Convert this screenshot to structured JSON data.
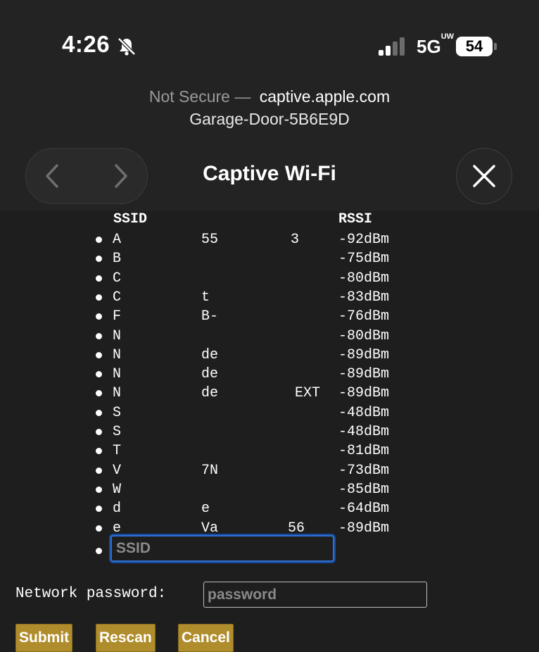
{
  "status_bar": {
    "time": "4:26",
    "network": "5G",
    "network_sup": "UW",
    "battery": "54",
    "icons": [
      "bell-slash-icon",
      "signal-icon"
    ]
  },
  "browser": {
    "security": "Not Secure —",
    "host": "captive.apple.com",
    "page_title": "Garage-Door-5B6E9D",
    "sheet_title": "Captive Wi-Fi",
    "icons": [
      "back-icon",
      "forward-icon",
      "close-icon"
    ]
  },
  "networks": {
    "header_ssid": "SSID",
    "header_rssi": "RSSI",
    "items": [
      {
        "ssid": "A",
        "frag1": "55",
        "frag2": "3",
        "rssi": "-92dBm"
      },
      {
        "ssid": "B",
        "frag1": "",
        "frag2": "",
        "rssi": "-75dBm"
      },
      {
        "ssid": "C",
        "frag1": "",
        "frag2": "",
        "rssi": "-80dBm"
      },
      {
        "ssid": "C",
        "frag1": "t",
        "frag2": "",
        "rssi": "-83dBm"
      },
      {
        "ssid": "F",
        "frag1": "B-",
        "frag2": "",
        "rssi": "-76dBm"
      },
      {
        "ssid": "N",
        "frag1": "",
        "frag2": "",
        "rssi": "-80dBm"
      },
      {
        "ssid": "N",
        "frag1": "de",
        "frag2": "",
        "rssi": "-89dBm"
      },
      {
        "ssid": "N",
        "frag1": "de",
        "frag2": "",
        "rssi": "-89dBm"
      },
      {
        "ssid": "N",
        "frag1": "de",
        "frag2": "EXT",
        "rssi": "-89dBm"
      },
      {
        "ssid": "S",
        "frag1": "",
        "frag2": "",
        "rssi": "-48dBm"
      },
      {
        "ssid": "S",
        "frag1": "",
        "frag2": "",
        "rssi": "-48dBm"
      },
      {
        "ssid": "T",
        "frag1": "",
        "frag2": "",
        "rssi": "-81dBm"
      },
      {
        "ssid": "V",
        "frag1": "7N",
        "frag2": "",
        "rssi": "-73dBm"
      },
      {
        "ssid": "W",
        "frag1": "",
        "frag2": "",
        "rssi": "-85dBm"
      },
      {
        "ssid": "d",
        "frag1": "e",
        "frag2": "",
        "rssi": "-64dBm"
      },
      {
        "ssid": "e",
        "frag1": "Va",
        "frag2": "56",
        "rssi": "-89dBm"
      }
    ]
  },
  "form": {
    "ssid_value": "",
    "ssid_placeholder": "SSID",
    "password_label": "Network password:",
    "password_value": "",
    "password_placeholder": "password",
    "buttons": {
      "submit": "Submit",
      "rescan": "Rescan",
      "cancel": "Cancel"
    }
  },
  "colors": {
    "background": "#1e1e1e",
    "button": "#b08d2c",
    "focus": "#2f6fd0"
  }
}
